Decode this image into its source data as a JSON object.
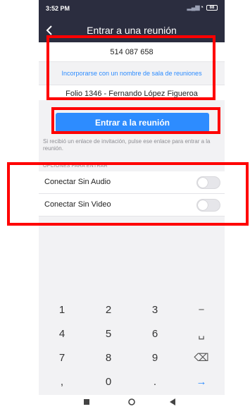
{
  "status_bar": {
    "time": "3:52 PM",
    "battery": "88"
  },
  "header": {
    "title": "Entrar a una reunión"
  },
  "form": {
    "meeting_id": "514 087 658",
    "join_by_room_name_link": "Incorporarse con un nombre de sala de reuniones",
    "display_name": "Folio 1346 - Fernando López Figueroa",
    "join_button": "Entrar a la reunión",
    "invitation_hint": "Si recibió un enlace de invitación, pulse ese enlace para entrar a la reunión."
  },
  "options": {
    "section_label": "OPCIONES PARA ENTRAR",
    "items": [
      {
        "label": "Conectar Sin Audio",
        "enabled": false
      },
      {
        "label": "Conectar Sin Video",
        "enabled": false
      }
    ]
  },
  "keypad": {
    "keys": [
      [
        "1",
        "2",
        "3",
        "−"
      ],
      [
        "4",
        "5",
        "6",
        "␣"
      ],
      [
        "7",
        "8",
        "9",
        "⌫"
      ],
      [
        ",",
        "0",
        ".",
        "→"
      ]
    ]
  },
  "colors": {
    "accent": "#2d8cff",
    "header": "#2b2d3f",
    "highlight": "#ff0000"
  },
  "icons": {
    "back": "chevron-left-icon",
    "backspace": "backspace-icon",
    "enter": "enter-arrow-icon",
    "space": "space-icon"
  }
}
